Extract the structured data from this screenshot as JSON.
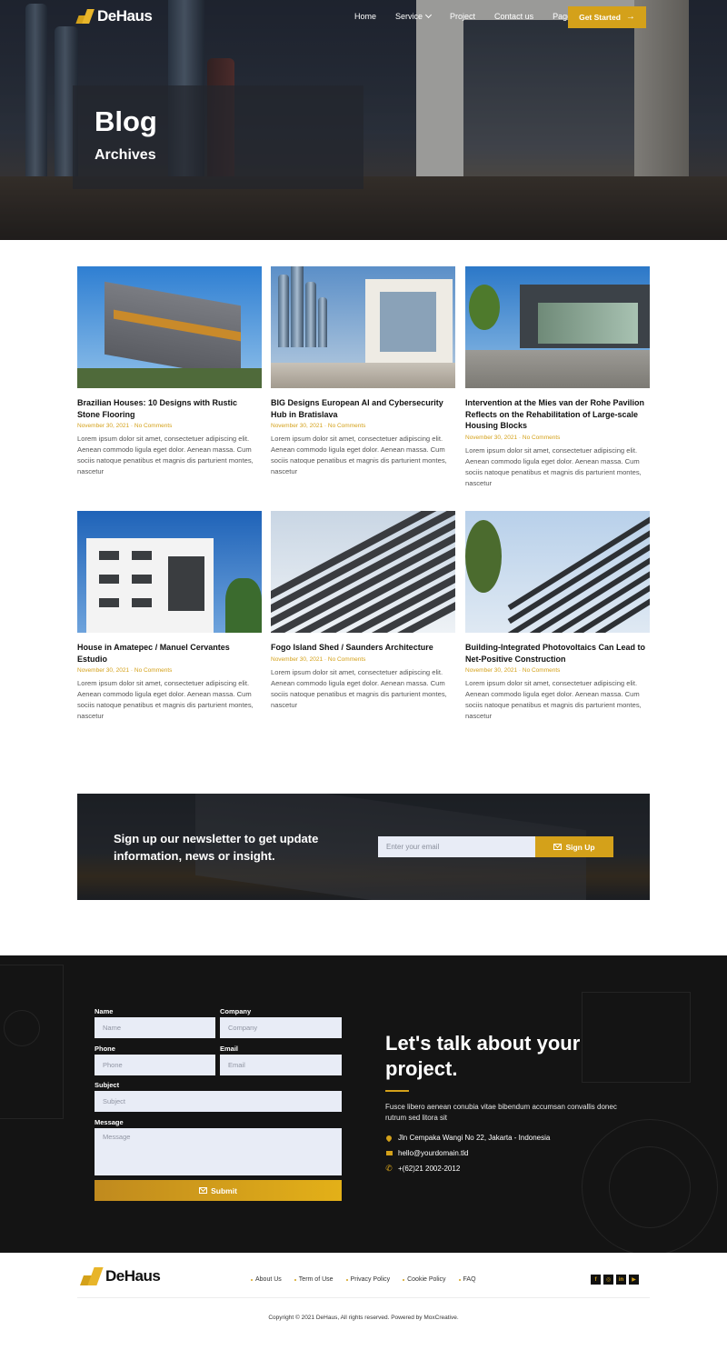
{
  "brand": {
    "name": "DeHaus",
    "accent": "#d4a11a"
  },
  "nav": {
    "items": [
      {
        "label": "Home",
        "dropdown": false
      },
      {
        "label": "Service",
        "dropdown": true
      },
      {
        "label": "Project",
        "dropdown": false
      },
      {
        "label": "Contact us",
        "dropdown": false
      },
      {
        "label": "Page",
        "dropdown": true
      }
    ],
    "cta_label": "Get Started"
  },
  "hero": {
    "title": "Blog",
    "subtitle": "Archives"
  },
  "posts": [
    {
      "title": "Brazilian Houses: 10 Designs with Rustic Stone Flooring",
      "date": "November 30, 2021",
      "comments": "No Comments",
      "excerpt": "Lorem ipsum dolor sit amet, consectetuer adipiscing elit. Aenean commodo ligula eget dolor. Aenean massa. Cum sociis natoque penatibus et magnis dis parturient montes, nascetur"
    },
    {
      "title": "BIG Designs European AI and Cybersecurity Hub in Bratislava",
      "date": "November 30, 2021",
      "comments": "No Comments",
      "excerpt": "Lorem ipsum dolor sit amet, consectetuer adipiscing elit. Aenean commodo ligula eget dolor. Aenean massa. Cum sociis natoque penatibus et magnis dis parturient montes, nascetur"
    },
    {
      "title": "Intervention at the Mies van der Rohe Pavilion Reflects on the Rehabilitation of Large-scale Housing Blocks",
      "date": "November 30, 2021",
      "comments": "No Comments",
      "excerpt": "Lorem ipsum dolor sit amet, consectetuer adipiscing elit. Aenean commodo ligula eget dolor. Aenean massa. Cum sociis natoque penatibus et magnis dis parturient montes, nascetur"
    },
    {
      "title": "House in Amatepec / Manuel Cervantes Estudio",
      "date": "November 30, 2021",
      "comments": "No Comments",
      "excerpt": "Lorem ipsum dolor sit amet, consectetuer adipiscing elit. Aenean commodo ligula eget dolor. Aenean massa. Cum sociis natoque penatibus et magnis dis parturient montes, nascetur"
    },
    {
      "title": "Fogo Island Shed / Saunders Architecture",
      "date": "November 30, 2021",
      "comments": "No Comments",
      "excerpt": "Lorem ipsum dolor sit amet, consectetuer adipiscing elit. Aenean commodo ligula eget dolor. Aenean massa. Cum sociis natoque penatibus et magnis dis parturient montes, nascetur"
    },
    {
      "title": "Building-Integrated Photovoltaics Can Lead to Net-Positive Construction",
      "date": "November 30, 2021",
      "comments": "No Comments",
      "excerpt": "Lorem ipsum dolor sit amet, consectetuer adipiscing elit. Aenean commodo ligula eget dolor. Aenean massa. Cum sociis natoque penatibus et magnis dis parturient montes, nascetur"
    }
  ],
  "newsletter": {
    "text": "Sign up our newsletter to get update information, news or insight.",
    "email_placeholder": "Enter your email",
    "button_label": "Sign Up"
  },
  "contact": {
    "form": {
      "name_label": "Name",
      "name_placeholder": "Name",
      "company_label": "Company",
      "company_placeholder": "Company",
      "phone_label": "Phone",
      "phone_placeholder": "Phone",
      "email_label": "Email",
      "email_placeholder": "Email",
      "subject_label": "Subject",
      "subject_placeholder": "Subject",
      "message_label": "Message",
      "message_placeholder": "Message",
      "submit_label": "Submit"
    },
    "title": "Let's talk about your project.",
    "description": "Fusce libero aenean conubia vitae bibendum accumsan convallis donec rutrum sed litora sit",
    "address": "Jln Cempaka Wangi No 22, Jakarta - Indonesia",
    "email": "hello@yourdomain.tld",
    "phone": "+(62)21 2002-2012"
  },
  "footer": {
    "links": [
      "About Us",
      "Term of Use",
      "Privacy Policy",
      "Cookie Policy",
      "FAQ"
    ],
    "socials": [
      {
        "icon": "facebook-icon",
        "glyph": "f"
      },
      {
        "icon": "instagram-icon",
        "glyph": "◎"
      },
      {
        "icon": "linkedin-icon",
        "glyph": "in"
      },
      {
        "icon": "youtube-icon",
        "glyph": "▶"
      }
    ],
    "copyright": "Copyright © 2021 DeHaus, All rights reserved. Powered by MoxCreative."
  }
}
